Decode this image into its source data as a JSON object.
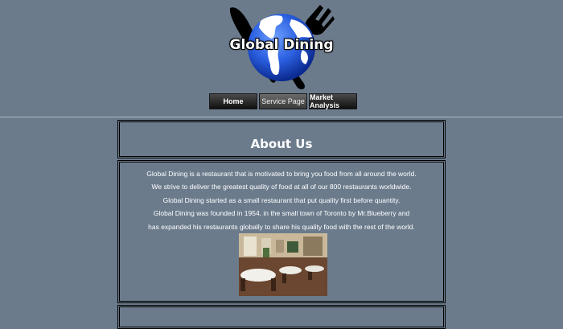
{
  "brand": {
    "title": "Global Dining"
  },
  "nav": {
    "items": [
      {
        "label": "Home"
      },
      {
        "label": "Service Page"
      },
      {
        "label": "Market Analysis"
      }
    ]
  },
  "about": {
    "heading": "About Us",
    "lines": [
      "Global Dining is a restaurant that is motivated to bring you food from all around the world.",
      "We strive to deliver the greatest quality of food at all of our 800 restaurants worldwide.",
      "Global Dining started as a small restaurant that put quality first before quantity.",
      "Global Dining was founded in 1954, in the small town of Toronto by Mr.Blueberry and",
      "has expanded his restaurants globally to share his quality food with the rest of the world."
    ]
  },
  "colors": {
    "background": "#6b7b8c",
    "globe": "#1f4fd0",
    "text": "#ffffff"
  }
}
